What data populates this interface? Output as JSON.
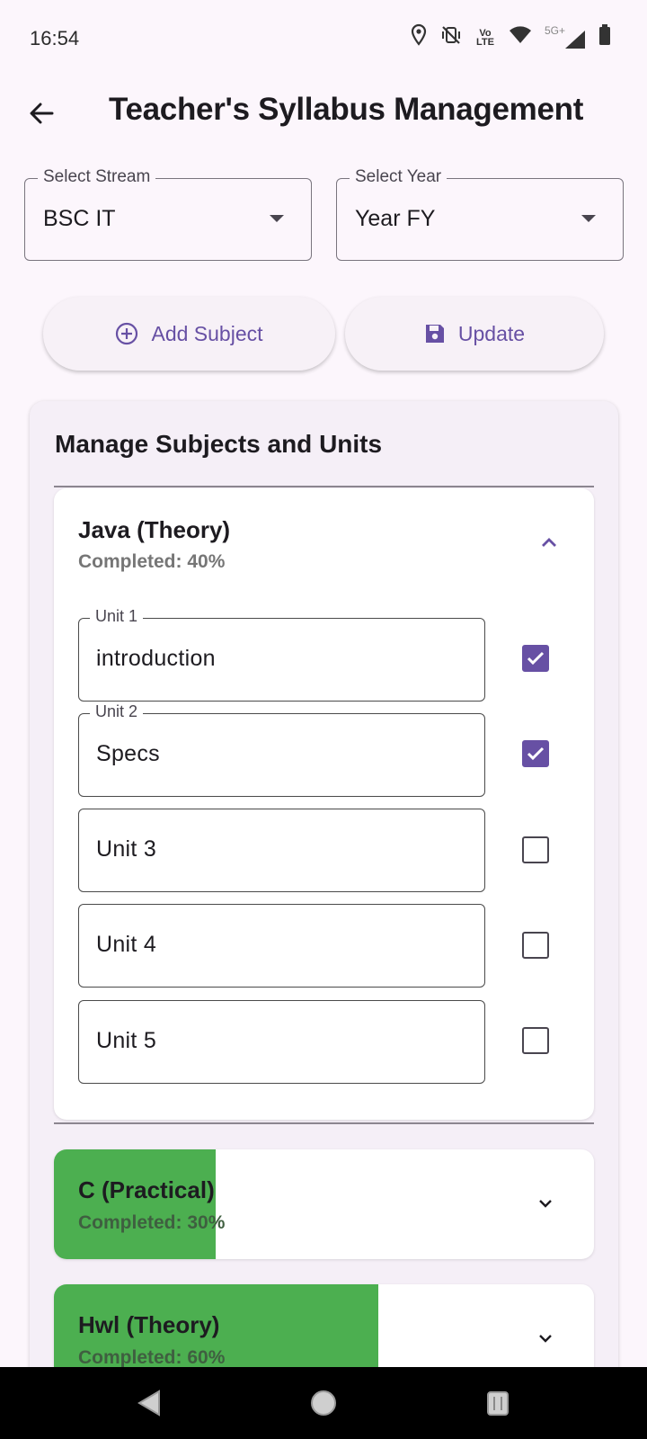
{
  "status_bar": {
    "time": "16:54",
    "icons": [
      "location-icon",
      "vibrate-off-icon",
      "volte-icon",
      "wifi-icon",
      "signal-5g-icon",
      "battery-icon"
    ],
    "network_label": "5G+",
    "volte_label": "Vo LTE"
  },
  "app_bar": {
    "title": "Teacher's Syllabus Management"
  },
  "filters": {
    "stream": {
      "label": "Select Stream",
      "value": "BSC IT"
    },
    "year": {
      "label": "Select Year",
      "value": "Year FY"
    }
  },
  "actions": {
    "add_subject": "Add Subject",
    "update": "Update"
  },
  "card": {
    "title": "Manage Subjects and Units",
    "subjects": [
      {
        "name": "Java (Theory)",
        "completed_label": "Completed: 40%",
        "progress": 0.4,
        "expanded": true,
        "units": [
          {
            "label": "Unit 1",
            "value": "introduction",
            "checked": true
          },
          {
            "label": "Unit 2",
            "value": "Specs",
            "checked": true
          },
          {
            "label": "",
            "value": "Unit 3",
            "checked": false
          },
          {
            "label": "",
            "value": "Unit 4",
            "checked": false
          },
          {
            "label": "",
            "value": "Unit 5",
            "checked": false
          }
        ]
      },
      {
        "name": "C (Practical)",
        "completed_label": "Completed: 30%",
        "progress": 0.3,
        "expanded": false
      },
      {
        "name": "Hwl (Theory)",
        "completed_label": "Completed: 60%",
        "progress": 0.6,
        "expanded": false
      }
    ]
  },
  "colors": {
    "accent": "#6750a4",
    "progress_green": "#4caf50",
    "background": "#fcf6fc"
  }
}
